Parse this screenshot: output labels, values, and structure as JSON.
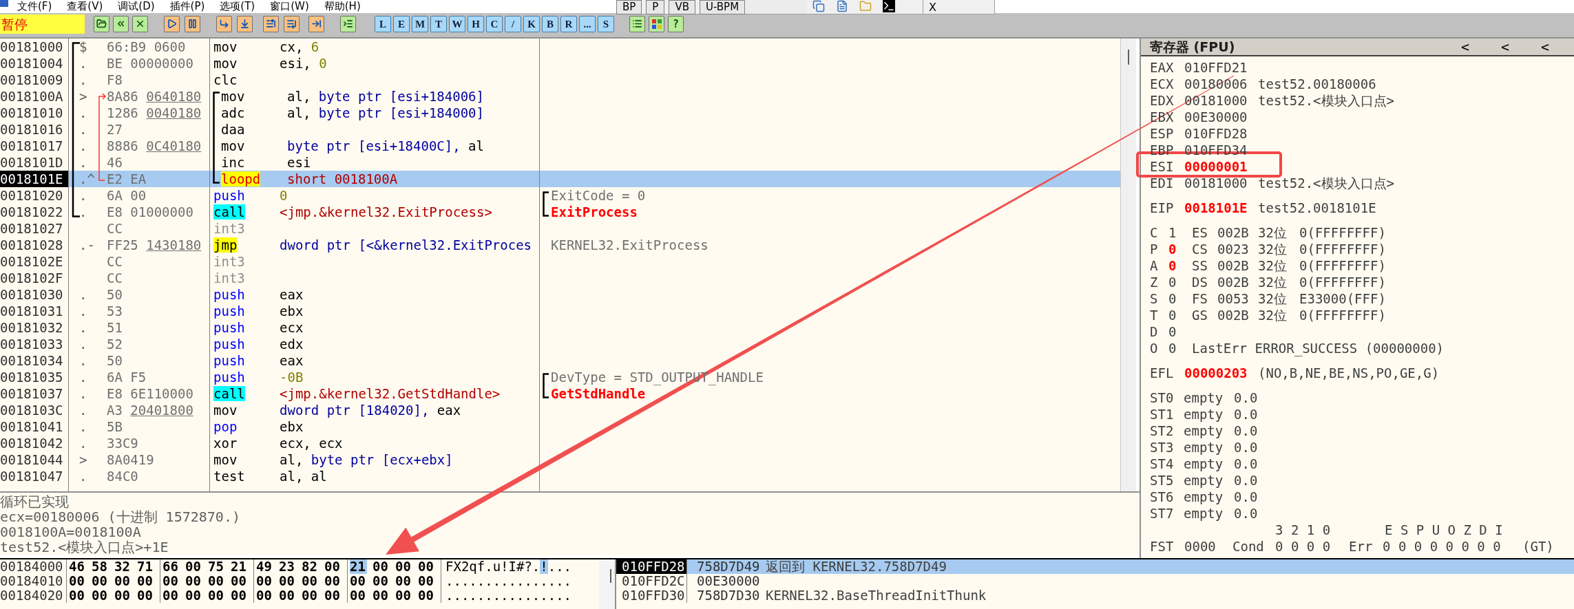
{
  "menu": [
    "文件(F)",
    "查看(V)",
    "调试(D)",
    "插件(P)",
    "选项(T)",
    "窗口(W)",
    "帮助(H)"
  ],
  "quick_buttons": [
    "BP",
    "P",
    "VB",
    "U-BPM"
  ],
  "close_button": "X",
  "status": "暂停",
  "toolbar_letters": [
    "L",
    "E",
    "M",
    "T",
    "W",
    "H",
    "C",
    "/",
    "K",
    "B",
    "R",
    "...",
    "S"
  ],
  "help": "?",
  "disasm": [
    {
      "address": "00181000",
      "selected": false,
      "mark": "$",
      "fn_start": true,
      "opcode": "66:B9 0600",
      "mnemonic": "mov",
      "kind": "plain",
      "operands": [
        {
          "text": "cx,",
          "kind": "reg"
        },
        {
          "text": "6",
          "kind": "imm"
        }
      ]
    },
    {
      "address": "00181004",
      "selected": false,
      "mark": ".",
      "opcode": "BE 00000000",
      "mnemonic": "mov",
      "kind": "plain",
      "operands": [
        {
          "text": "esi,",
          "kind": "reg"
        },
        {
          "text": "0",
          "kind": "imm"
        }
      ]
    },
    {
      "address": "00181009",
      "selected": false,
      "mark": ".",
      "opcode": "F8",
      "mnemonic": "clc",
      "kind": "plain"
    },
    {
      "address": "0018100A",
      "selected": false,
      "mark": ">",
      "opcode": "8A86",
      "fixup": "0640180",
      "loop_start": true,
      "mnemonic": "mov",
      "kind": "plain",
      "operands": [
        {
          "text": "al,",
          "kind": "reg"
        },
        {
          "text": "byte ptr [esi+184006]",
          "kind": "mem"
        }
      ]
    },
    {
      "address": "00181010",
      "selected": false,
      "mark": ".",
      "opcode": "1286",
      "fixup": "0040180",
      "mnemonic": "adc",
      "kind": "plain",
      "operands": [
        {
          "text": "al,",
          "kind": "reg"
        },
        {
          "text": "byte ptr [esi+184000]",
          "kind": "mem"
        }
      ]
    },
    {
      "address": "00181016",
      "selected": false,
      "mark": ".",
      "opcode": "27",
      "mnemonic": "daa",
      "kind": "plain"
    },
    {
      "address": "00181017",
      "selected": false,
      "mark": ".",
      "opcode": "8886",
      "fixup": "0C40180",
      "mnemonic": "mov",
      "kind": "plain",
      "operands": [
        {
          "text": "byte ptr [esi+18400C],",
          "kind": "mem"
        },
        {
          "text": "al",
          "kind": "reg"
        }
      ]
    },
    {
      "address": "0018101D",
      "selected": false,
      "mark": ".",
      "opcode": "46",
      "mnemonic": "inc",
      "kind": "plain",
      "operands": [
        {
          "text": "esi",
          "kind": "reg"
        }
      ]
    },
    {
      "address": "0018101E",
      "selected": true,
      "mark": ".^",
      "opcode": "E2 EA",
      "loop_end": true,
      "mnemonic": "loopd",
      "kind": "loop",
      "operands": [
        {
          "text": "short 0018100A",
          "kind": "target"
        }
      ]
    },
    {
      "address": "00181020",
      "selected": false,
      "mark": ".",
      "opcode": "6A 00",
      "mnemonic": "push",
      "kind": "stack",
      "operands": [
        {
          "text": "0",
          "kind": "imm"
        }
      ],
      "comment": {
        "text": "ExitCode = 0",
        "kind": "note"
      },
      "bracket_start": true
    },
    {
      "address": "00181022",
      "selected": false,
      "mark": ".",
      "fn_end": true,
      "opcode": "E8 01000000",
      "mnemonic": "call",
      "kind": "call",
      "operands": [
        {
          "text": "<jmp.&kernel32.ExitProcess>",
          "kind": "target"
        }
      ],
      "comment": {
        "text": "ExitProcess",
        "kind": "api"
      },
      "bracket_end": true
    },
    {
      "address": "00181027",
      "selected": false,
      "opcode": "CC",
      "mnemonic": "int3",
      "kind": "filler"
    },
    {
      "address": "00181028",
      "selected": false,
      "mark": ".-",
      "opcode": "FF25",
      "fixup": "1430180",
      "mnemonic": "jmp",
      "kind": "jump",
      "operands": [
        {
          "text": "dword ptr [<&kernel32.ExitProces",
          "kind": "mem"
        }
      ],
      "comment": {
        "text": "KERNEL32.ExitProcess",
        "kind": "note"
      }
    },
    {
      "address": "0018102E",
      "selected": false,
      "opcode": "CC",
      "mnemonic": "int3",
      "kind": "filler"
    },
    {
      "address": "0018102F",
      "selected": false,
      "opcode": "CC",
      "mnemonic": "int3",
      "kind": "filler"
    },
    {
      "address": "00181030",
      "selected": false,
      "mark": ".",
      "opcode": "50",
      "mnemonic": "push",
      "kind": "stack",
      "operands": [
        {
          "text": "eax",
          "kind": "reg"
        }
      ]
    },
    {
      "address": "00181031",
      "selected": false,
      "mark": ".",
      "opcode": "53",
      "mnemonic": "push",
      "kind": "stack",
      "operands": [
        {
          "text": "ebx",
          "kind": "reg"
        }
      ]
    },
    {
      "address": "00181032",
      "selected": false,
      "mark": ".",
      "opcode": "51",
      "mnemonic": "push",
      "kind": "stack",
      "operands": [
        {
          "text": "ecx",
          "kind": "reg"
        }
      ]
    },
    {
      "address": "00181033",
      "selected": false,
      "mark": ".",
      "opcode": "52",
      "mnemonic": "push",
      "kind": "stack",
      "operands": [
        {
          "text": "edx",
          "kind": "reg"
        }
      ]
    },
    {
      "address": "00181034",
      "selected": false,
      "mark": ".",
      "opcode": "50",
      "mnemonic": "push",
      "kind": "stack",
      "operands": [
        {
          "text": "eax",
          "kind": "reg"
        }
      ]
    },
    {
      "address": "00181035",
      "selected": false,
      "mark": ".",
      "opcode": "6A F5",
      "mnemonic": "push",
      "kind": "stack",
      "operands": [
        {
          "text": "-0B",
          "kind": "imm"
        }
      ],
      "comment": {
        "text": "DevType = STD_OUTPUT_HANDLE",
        "kind": "note"
      },
      "bracket_start": true
    },
    {
      "address": "00181037",
      "selected": false,
      "mark": ".",
      "opcode": "E8 6E110000",
      "mnemonic": "call",
      "kind": "call",
      "operands": [
        {
          "text": "<jmp.&kernel32.GetStdHandle>",
          "kind": "target"
        }
      ],
      "comment": {
        "text": "GetStdHandle",
        "kind": "api"
      },
      "bracket_end": true
    },
    {
      "address": "0018103C",
      "selected": false,
      "mark": ".",
      "opcode": "A3",
      "fixup": "20401800",
      "mnemonic": "mov",
      "kind": "plain",
      "operands": [
        {
          "text": "dword ptr [184020],",
          "kind": "mem"
        },
        {
          "text": "eax",
          "kind": "reg"
        }
      ]
    },
    {
      "address": "00181041",
      "selected": false,
      "mark": ".",
      "opcode": "5B",
      "mnemonic": "pop",
      "kind": "stack",
      "operands": [
        {
          "text": "ebx",
          "kind": "reg"
        }
      ]
    },
    {
      "address": "00181042",
      "selected": false,
      "mark": ".",
      "opcode": "33C9",
      "mnemonic": "xor",
      "kind": "plain",
      "operands": [
        {
          "text": "ecx,",
          "kind": "reg"
        },
        {
          "text": "ecx",
          "kind": "reg"
        }
      ]
    },
    {
      "address": "00181044",
      "selected": false,
      "mark": ">",
      "opcode": "8A0419",
      "mnemonic": "mov",
      "kind": "plain",
      "operands": [
        {
          "text": "al,",
          "kind": "reg"
        },
        {
          "text": "byte ptr [ecx+ebx]",
          "kind": "mem"
        }
      ]
    },
    {
      "address": "00181047",
      "selected": false,
      "mark": ".",
      "opcode": "84C0",
      "mnemonic": "test",
      "kind": "plain",
      "operands": [
        {
          "text": "al,",
          "kind": "reg"
        },
        {
          "text": "al",
          "kind": "reg"
        }
      ]
    }
  ],
  "info": [
    "循环已实现",
    "ecx=00180006 (十进制 1572870.)",
    "0018100A=0018100A",
    "test52.<模块入口点>+1E"
  ],
  "registers": {
    "title": "寄存器 (FPU)",
    "nav": [
      "<",
      "<",
      "<"
    ],
    "general": [
      {
        "name": "EAX",
        "value": "010FFD21",
        "changed": false
      },
      {
        "name": "ECX",
        "value": "00180006",
        "changed": false,
        "comment": "test52.00180006"
      },
      {
        "name": "EDX",
        "value": "00181000",
        "changed": false,
        "comment": "test52.<模块入口点>"
      },
      {
        "name": "EBX",
        "value": "00E30000",
        "changed": false
      },
      {
        "name": "ESP",
        "value": "010FFD28",
        "changed": false
      },
      {
        "name": "EBP",
        "value": "010FFD34",
        "changed": false
      },
      {
        "name": "ESI",
        "value": "00000001",
        "changed": true
      },
      {
        "name": "EDI",
        "value": "00181000",
        "changed": false,
        "comment": "test52.<模块入口点>"
      }
    ],
    "eip": {
      "name": "EIP",
      "value": "0018101E",
      "changed": true,
      "comment": "test52.0018101E"
    },
    "flags": [
      {
        "flag": "C",
        "bit": "1",
        "changed": false,
        "segment": "ES",
        "selector": "002B",
        "width": "32位",
        "base": "0(FFFFFFFF)"
      },
      {
        "flag": "P",
        "bit": "0",
        "changed": true,
        "segment": "CS",
        "selector": "0023",
        "width": "32位",
        "base": "0(FFFFFFFF)"
      },
      {
        "flag": "A",
        "bit": "0",
        "changed": true,
        "segment": "SS",
        "selector": "002B",
        "width": "32位",
        "base": "0(FFFFFFFF)"
      },
      {
        "flag": "Z",
        "bit": "0",
        "changed": false,
        "segment": "DS",
        "selector": "002B",
        "width": "32位",
        "base": "0(FFFFFFFF)"
      },
      {
        "flag": "S",
        "bit": "0",
        "changed": false,
        "segment": "FS",
        "selector": "0053",
        "width": "32位",
        "base": "E33000(FFF)"
      },
      {
        "flag": "T",
        "bit": "0",
        "changed": false,
        "segment": "GS",
        "selector": "002B",
        "width": "32位",
        "base": "0(FFFFFFFF)"
      },
      {
        "flag": "D",
        "bit": "0",
        "changed": false
      },
      {
        "flag": "O",
        "bit": "0",
        "changed": false,
        "last_error": "LastErr ERROR_SUCCESS (00000000)"
      }
    ],
    "efl": {
      "name": "EFL",
      "value": "00000203",
      "changed": true,
      "conditions": "(NO,B,NE,BE,NS,PO,GE,G)"
    },
    "fpu": [
      {
        "name": "ST0",
        "tag": "empty",
        "value": "0.0"
      },
      {
        "name": "ST1",
        "tag": "empty",
        "value": "0.0"
      },
      {
        "name": "ST2",
        "tag": "empty",
        "value": "0.0"
      },
      {
        "name": "ST3",
        "tag": "empty",
        "value": "0.0"
      },
      {
        "name": "ST4",
        "tag": "empty",
        "value": "0.0"
      },
      {
        "name": "ST5",
        "tag": "empty",
        "value": "0.0"
      },
      {
        "name": "ST6",
        "tag": "empty",
        "value": "0.0"
      },
      {
        "name": "ST7",
        "tag": "empty",
        "value": "0.0"
      }
    ],
    "fpu_header": {
      "cond_bits": "3 2 1 0",
      "err_bits": "E S P U O Z D I"
    },
    "fst": {
      "name": "FST",
      "value": "0000",
      "cond_label": "Cond",
      "cond": "0 0 0 0",
      "err_label": "Err",
      "err": "0 0 0 0 0 0 0 0",
      "status": "(GT)"
    }
  },
  "dump": [
    {
      "address": "00184000",
      "ascii": "FX2qf.u!I#?.!...",
      "bytes": [
        {
          "text": "46",
          "selected": false
        },
        {
          "text": "58",
          "selected": false
        },
        {
          "text": "32",
          "selected": false
        },
        {
          "text": "71",
          "selected": false
        },
        {
          "text": "66",
          "selected": false
        },
        {
          "text": "00",
          "selected": false
        },
        {
          "text": "75",
          "selected": false
        },
        {
          "text": "21",
          "selected": false
        },
        {
          "text": "49",
          "selected": false
        },
        {
          "text": "23",
          "selected": false
        },
        {
          "text": "82",
          "selected": false
        },
        {
          "text": "00",
          "selected": false
        },
        {
          "text": "21",
          "selected": true
        },
        {
          "text": "00",
          "selected": false
        },
        {
          "text": "00",
          "selected": false
        },
        {
          "text": "00",
          "selected": false
        }
      ]
    },
    {
      "address": "00184010",
      "ascii": "................",
      "bytes": [
        {
          "text": "00",
          "selected": false
        },
        {
          "text": "00",
          "selected": false
        },
        {
          "text": "00",
          "selected": false
        },
        {
          "text": "00",
          "selected": false
        },
        {
          "text": "00",
          "selected": false
        },
        {
          "text": "00",
          "selected": false
        },
        {
          "text": "00",
          "selected": false
        },
        {
          "text": "00",
          "selected": false
        },
        {
          "text": "00",
          "selected": false
        },
        {
          "text": "00",
          "selected": false
        },
        {
          "text": "00",
          "selected": false
        },
        {
          "text": "00",
          "selected": false
        },
        {
          "text": "00",
          "selected": false
        },
        {
          "text": "00",
          "selected": false
        },
        {
          "text": "00",
          "selected": false
        },
        {
          "text": "00",
          "selected": false
        }
      ]
    },
    {
      "address": "00184020",
      "ascii": "................",
      "bytes": [
        {
          "text": "00",
          "selected": false
        },
        {
          "text": "00",
          "selected": false
        },
        {
          "text": "00",
          "selected": false
        },
        {
          "text": "00",
          "selected": false
        },
        {
          "text": "00",
          "selected": false
        },
        {
          "text": "00",
          "selected": false
        },
        {
          "text": "00",
          "selected": false
        },
        {
          "text": "00",
          "selected": false
        },
        {
          "text": "00",
          "selected": false
        },
        {
          "text": "00",
          "selected": false
        },
        {
          "text": "00",
          "selected": false
        },
        {
          "text": "00",
          "selected": false
        },
        {
          "text": "00",
          "selected": false
        },
        {
          "text": "00",
          "selected": false
        },
        {
          "text": "00",
          "selected": false
        },
        {
          "text": "00",
          "selected": false
        }
      ]
    }
  ],
  "stack": [
    {
      "address": "010FFD28",
      "value": "758D7D49",
      "comment": "返回到 KERNEL32.758D7D49",
      "selected": true
    },
    {
      "address": "010FFD2C",
      "value": "00E30000",
      "selected": false
    },
    {
      "address": "010FFD30",
      "value": "758D7D30",
      "comment": "KERNEL32.BaseThreadInitThunk",
      "selected": false
    }
  ]
}
